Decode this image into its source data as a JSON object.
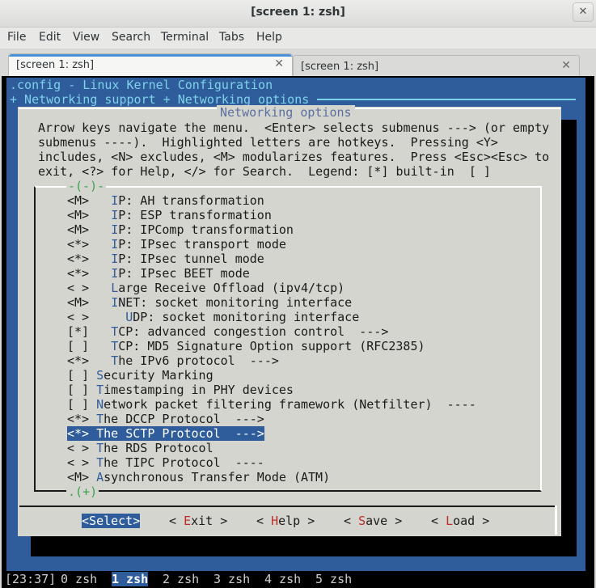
{
  "window": {
    "title": "[screen 1: zsh]",
    "close_glyph": "✕"
  },
  "menubar": {
    "items": [
      "File",
      "Edit",
      "View",
      "Search",
      "Terminal",
      "Tabs",
      "Help"
    ]
  },
  "tabs": [
    {
      "label": "[screen 1: zsh]",
      "active": true
    },
    {
      "label": "[screen 1: zsh]",
      "active": false
    }
  ],
  "menuconfig": {
    "title_line": ".config - Linux Kernel Configuration",
    "path_line": "+ Networking support + Networking options",
    "dialog_title": "Networking options",
    "help_lines": [
      "Arrow keys navigate the menu.  <Enter> selects submenus ---> (or empty",
      "submenus ----).  Highlighted letters are hotkeys.  Pressing <Y>",
      "includes, <N> excludes, <M> modularizes features.  Press <Esc><Esc> to",
      "exit, <?> for Help, </> for Search.  Legend: [*] built-in  [ ]"
    ],
    "scroll_up": "-(-)-",
    "scroll_down": ".(+)",
    "items": [
      {
        "prefix": "<M>   ",
        "hotkey": "I",
        "rest": "P: AH transformation"
      },
      {
        "prefix": "<M>   ",
        "hotkey": "I",
        "rest": "P: ESP transformation"
      },
      {
        "prefix": "<M>   ",
        "hotkey": "I",
        "rest": "P: IPComp transformation"
      },
      {
        "prefix": "<*>   ",
        "hotkey": "I",
        "rest": "P: IPsec transport mode"
      },
      {
        "prefix": "<*>   ",
        "hotkey": "I",
        "rest": "P: IPsec tunnel mode"
      },
      {
        "prefix": "<*>   ",
        "hotkey": "I",
        "rest": "P: IPsec BEET mode"
      },
      {
        "prefix": "< >   ",
        "hotkey": "L",
        "rest": "arge Receive Offload (ipv4/tcp)"
      },
      {
        "prefix": "<M>   ",
        "hotkey": "I",
        "rest": "NET: socket monitoring interface"
      },
      {
        "prefix": "< >     ",
        "hotkey": "U",
        "rest": "DP: socket monitoring interface"
      },
      {
        "prefix": "[*]   ",
        "hotkey": "T",
        "rest": "CP: advanced congestion control  --->"
      },
      {
        "prefix": "[ ]   ",
        "hotkey": "T",
        "rest": "CP: MD5 Signature Option support (RFC2385)"
      },
      {
        "prefix": "<*>   ",
        "hotkey": "T",
        "rest": "he IPv6 protocol  --->"
      },
      {
        "prefix": "[ ] ",
        "hotkey": "S",
        "rest": "ecurity Marking"
      },
      {
        "prefix": "[ ] ",
        "hotkey": "T",
        "rest": "imestamping in PHY devices"
      },
      {
        "prefix": "[ ] ",
        "hotkey": "N",
        "rest": "etwork packet filtering framework (Netfilter)  ----"
      },
      {
        "prefix": "<*> ",
        "hotkey": "T",
        "rest": "he DCCP Protocol  --->"
      },
      {
        "prefix": "<*> ",
        "hotkey": "T",
        "rest": "he SCTP Protocol  --->",
        "selected": true
      },
      {
        "prefix": "< > ",
        "hotkey": "T",
        "rest": "he RDS Protocol"
      },
      {
        "prefix": "< > ",
        "hotkey": "T",
        "rest": "he TIPC Protocol  ----"
      },
      {
        "prefix": "<M> ",
        "hotkey": "A",
        "rest": "synchronous Transfer Mode (ATM)"
      }
    ],
    "buttons": [
      {
        "open": "<",
        "hotkey": "S",
        "rest": "elect",
        "close": ">",
        "active": true
      },
      {
        "open": "< ",
        "hotkey": "E",
        "rest": "xit",
        "close": " >"
      },
      {
        "open": "< ",
        "hotkey": "H",
        "rest": "elp",
        "close": " >"
      },
      {
        "open": "< ",
        "hotkey": "S",
        "rest": "ave",
        "close": " >"
      },
      {
        "open": "< ",
        "hotkey": "L",
        "rest": "oad",
        "close": " >"
      }
    ]
  },
  "screen_status": {
    "clock": "[23:37]",
    "windows": [
      {
        "label": "0 zsh",
        "current": false
      },
      {
        "label": "1 zsh",
        "current": true
      },
      {
        "label": "2 zsh",
        "current": false
      },
      {
        "label": "3 zsh",
        "current": false
      },
      {
        "label": "4 zsh",
        "current": false
      },
      {
        "label": "5 zsh",
        "current": false
      }
    ]
  },
  "colors": {
    "terminal_blue": "#2f5c9b",
    "dialog_gray": "#d5d5cf",
    "hotkey_red": "#c02a28",
    "title_cyan": "#7dd3e8",
    "tab_accent": "#4a90d9"
  }
}
